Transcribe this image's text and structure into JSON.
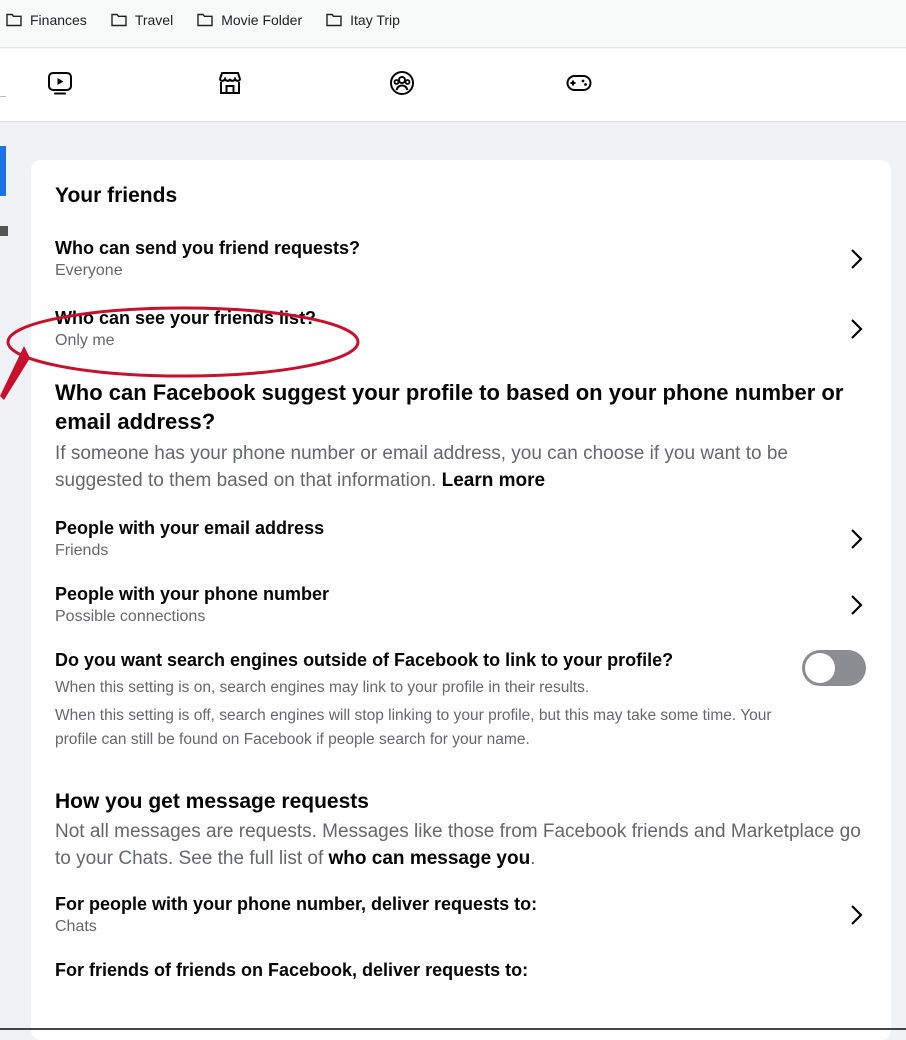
{
  "bookmarks": [
    "Finances",
    "Travel",
    "Movie Folder",
    "Itay Trip"
  ],
  "nav_icons": [
    "video-icon",
    "marketplace-icon",
    "groups-icon",
    "gaming-icon"
  ],
  "friends": {
    "title": "Your friends",
    "requests": {
      "title": "Who can send you friend requests?",
      "value": "Everyone"
    },
    "list": {
      "title": "Who can see your friends list?",
      "value": "Only me"
    }
  },
  "suggest": {
    "title": "Who can Facebook suggest your profile to based on your phone number or email address?",
    "desc": "If someone has your phone number or email address, you can choose if you want to be suggested to them based on that information.",
    "learn_more": "Learn more",
    "email": {
      "title": "People with your email address",
      "value": "Friends"
    },
    "phone": {
      "title": "People with your phone number",
      "value": "Possible connections"
    }
  },
  "search": {
    "title": "Do you want search engines outside of Facebook to link to your profile?",
    "on_text": "When this setting is on, search engines may link to your profile in their results.",
    "off_text": "When this setting is off, search engines will stop linking to your profile, but this may take some time. Your profile can still be found on Facebook if people search for your name.",
    "enabled": false
  },
  "messages": {
    "title": "How you get message requests",
    "desc": "Not all messages are requests. Messages like those from Facebook friends and Marketplace go to your Chats. See the full list of",
    "link": "who can message you",
    "phone": {
      "title": "For people with your phone number, deliver requests to:",
      "value": "Chats"
    },
    "fof": {
      "title": "For friends of friends on Facebook, deliver requests to:"
    }
  },
  "colors": {
    "accent": "#1b74e4",
    "annotation": "#c8102e",
    "toggle_off": "#8a8d91"
  }
}
